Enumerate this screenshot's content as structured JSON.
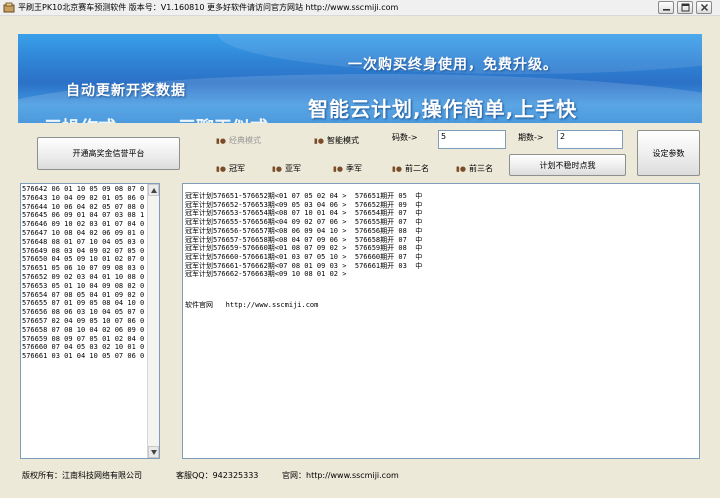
{
  "window": {
    "title": "平刷王PK10北京赛车预测软件     版本号：V1.160810     更多好软件请访问官方网站 http://www.sscmiji.com"
  },
  "banner": {
    "slogan_left": "自动更新开奖数据",
    "slogan_top": "一次购买终身使用，免费升级。",
    "slogan_main": "智能云计划,操作简单,上手快",
    "slogan_cut_1": "三操作式",
    "slogan_cut_2": "三聊天似式"
  },
  "controls": {
    "platform_button": "开通高奖金信誉平台",
    "mode_classic": "经典模式",
    "mode_smart": "智能模式",
    "digits_label": "码数->",
    "digits_value": "5",
    "periods_label": "期数->",
    "periods_value": "2",
    "settings_button": "设定参数",
    "plan_button": "计划不稳时点我",
    "positions": [
      "冠军",
      "亚军",
      "季军",
      "前二名",
      "前三名"
    ]
  },
  "history": {
    "rows": [
      "576642 06 01 10 05 09 08 07 0",
      "576643 10 04 09 02 01 05 06 0",
      "576644 10 06 04 02 05 07 08 0",
      "576645 06 09 01 04 07 03 08 1",
      "576646 09 10 02 03 01 07 04 0",
      "576647 10 08 04 02 06 09 01 0",
      "576648 08 01 07 10 04 05 03 0",
      "576649 08 03 04 09 02 07 05 0",
      "576650 04 05 09 10 01 02 07 0",
      "576651 05 06 10 07 09 08 03 0",
      "576652 09 02 03 04 01 10 08 0",
      "576653 05 01 10 04 09 08 02 0",
      "576654 07 08 05 04 01 09 02 0",
      "576655 07 01 09 05 08 04 10 0",
      "576656 08 06 03 10 04 05 07 0",
      "576657 02 04 09 05 10 07 06 0",
      "576658 07 08 10 04 02 06 09 0",
      "576659 08 09 07 05 01 02 04 0",
      "576660 07 04 05 03 02 10 01 0",
      "576661 03 01 04 10 05 07 06 0"
    ]
  },
  "output": {
    "lines": [
      "冠军计划576651-576652期<01 07 05 02 04 >  576651期开 05  中",
      "冠军计划576652-576653期<09 05 03 04 06 >  576652期开 09  中",
      "冠军计划576653-576654期<08 07 10 01 04 >  576654期开 07  中",
      "冠军计划576655-576656期<04 09 02 07 06 >  576655期开 07  中",
      "冠军计划576656-576657期<08 06 09 04 10 >  576656期开 08  中",
      "冠军计划576657-576658期<08 04 07 09 06 >  576658期开 07  中",
      "冠军计划576659-576660期<01 08 07 09 02 >  576659期开 08  中",
      "冠军计划576660-576661期<01 03 07 05 10 >  576660期开 07  中",
      "冠军计划576661-576662期<07 08 01 09 03 >  576661期开 03  中",
      "冠军计划576662-576663期<09 10 08 01 02 >"
    ],
    "site_line": "软件官网   http://www.sscmiji.com"
  },
  "footer": {
    "copyright": "版权所有：江南科技网络有限公司",
    "qq": "客服QQ：942325333",
    "site": "官网：http://www.sscmiji.com"
  },
  "icons": {
    "app": "app-icon",
    "minimize": "minimize-icon",
    "maximize": "maximize-icon",
    "close": "close-icon"
  }
}
